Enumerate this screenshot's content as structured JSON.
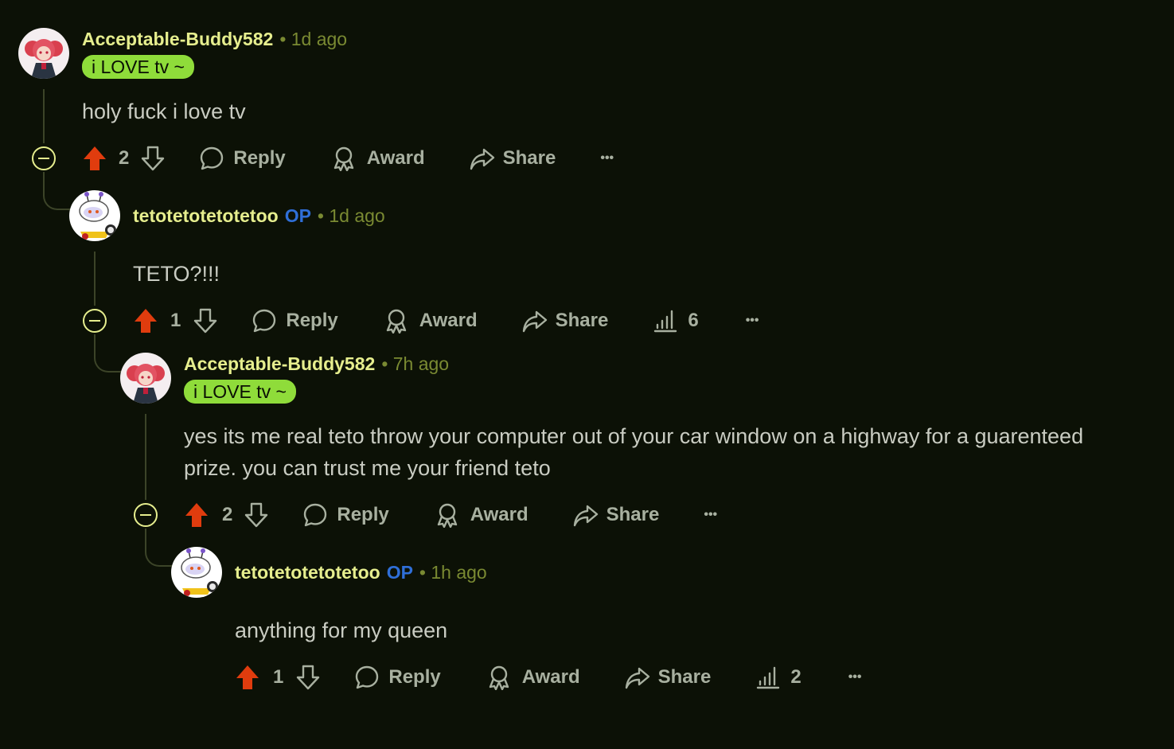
{
  "comments": [
    {
      "username": "Acceptable-Buddy582",
      "time": "• 1d ago",
      "flair": "i LOVE tv ~",
      "body": "holy fuck i love tv",
      "votes": "2",
      "reply": "Reply",
      "award": "Award",
      "share": "Share",
      "more": "•••"
    },
    {
      "username": "tetotetotetotetoo",
      "op": "OP",
      "time": "• 1d ago",
      "body": "TETO?!!!",
      "votes": "1",
      "reply": "Reply",
      "award": "Award",
      "share": "Share",
      "insights": "6",
      "more": "•••"
    },
    {
      "username": "Acceptable-Buddy582",
      "time": "• 7h ago",
      "flair": "i LOVE tv ~",
      "body": "yes its me real teto throw your computer out of your car window on a highway for a guarenteed prize. you can trust me your friend teto",
      "votes": "2",
      "reply": "Reply",
      "award": "Award",
      "share": "Share",
      "more": "•••"
    },
    {
      "username": "tetotetotetotetoo",
      "op": "OP",
      "time": "• 1h ago",
      "body": "anything for my queen",
      "votes": "1",
      "reply": "Reply",
      "award": "Award",
      "share": "Share",
      "insights": "2",
      "more": "•••"
    }
  ],
  "colors": {
    "background": "#0c1106",
    "username": "#e6ee8e",
    "op_badge": "#2f6fd8",
    "flair_bg": "#8fdc3a",
    "upvote_active": "#e03c0e",
    "thread_line": "#3c4428"
  },
  "icons": [
    "upvote-icon",
    "downvote-icon",
    "comment-icon",
    "award-icon",
    "share-icon",
    "insights-icon",
    "more-icon",
    "collapse-icon"
  ]
}
